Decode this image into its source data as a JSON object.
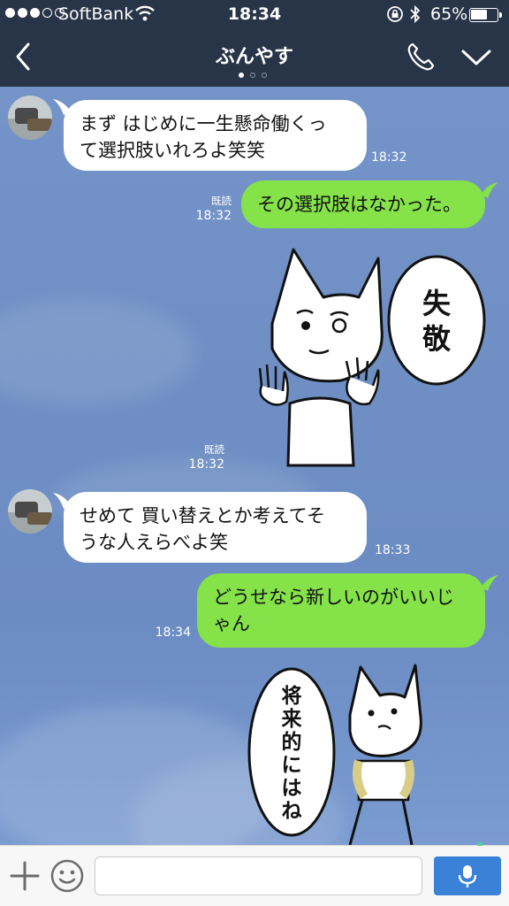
{
  "status_bar": {
    "carrier": "SoftBank",
    "time": "18:34",
    "battery_percent": "65%",
    "battery_level": 0.65
  },
  "header": {
    "title": "ぶんやす",
    "page_count": 3,
    "active_page": 1
  },
  "messages": [
    {
      "side": "in",
      "text": "まず はじめに一生懸命働くっ\nて選択肢いれろよ笑笑",
      "time": "18:32"
    },
    {
      "side": "out",
      "text": "その選択肢はなかった。",
      "read": "既読",
      "time": "18:32"
    },
    {
      "side": "out",
      "type": "sticker",
      "sticker_text": "失\n敬",
      "read": "既読",
      "time": "18:32"
    },
    {
      "side": "in",
      "text": "せめて 買い替えとか考えてそ\nうな人えらべよ笑",
      "time": "18:33"
    },
    {
      "side": "out",
      "text": "どうせなら新しいのがいいじ\nゃん",
      "time": "18:34"
    },
    {
      "side": "out",
      "type": "sticker",
      "sticker_text": "将\n来\n的\nに\nは\nね"
    }
  ],
  "input": {
    "placeholder": ""
  },
  "colors": {
    "header_bg": "#283447",
    "chat_bg": "#6f8fc4",
    "outgoing_bubble": "#85e249",
    "incoming_bubble": "#ffffff",
    "send_button": "#3a82d8"
  },
  "icons": {
    "back": "chevron-left-icon",
    "call": "phone-icon",
    "menu": "chevron-down-icon",
    "add": "plus-icon",
    "emoji": "smiley-icon",
    "voice": "microphone-icon"
  }
}
